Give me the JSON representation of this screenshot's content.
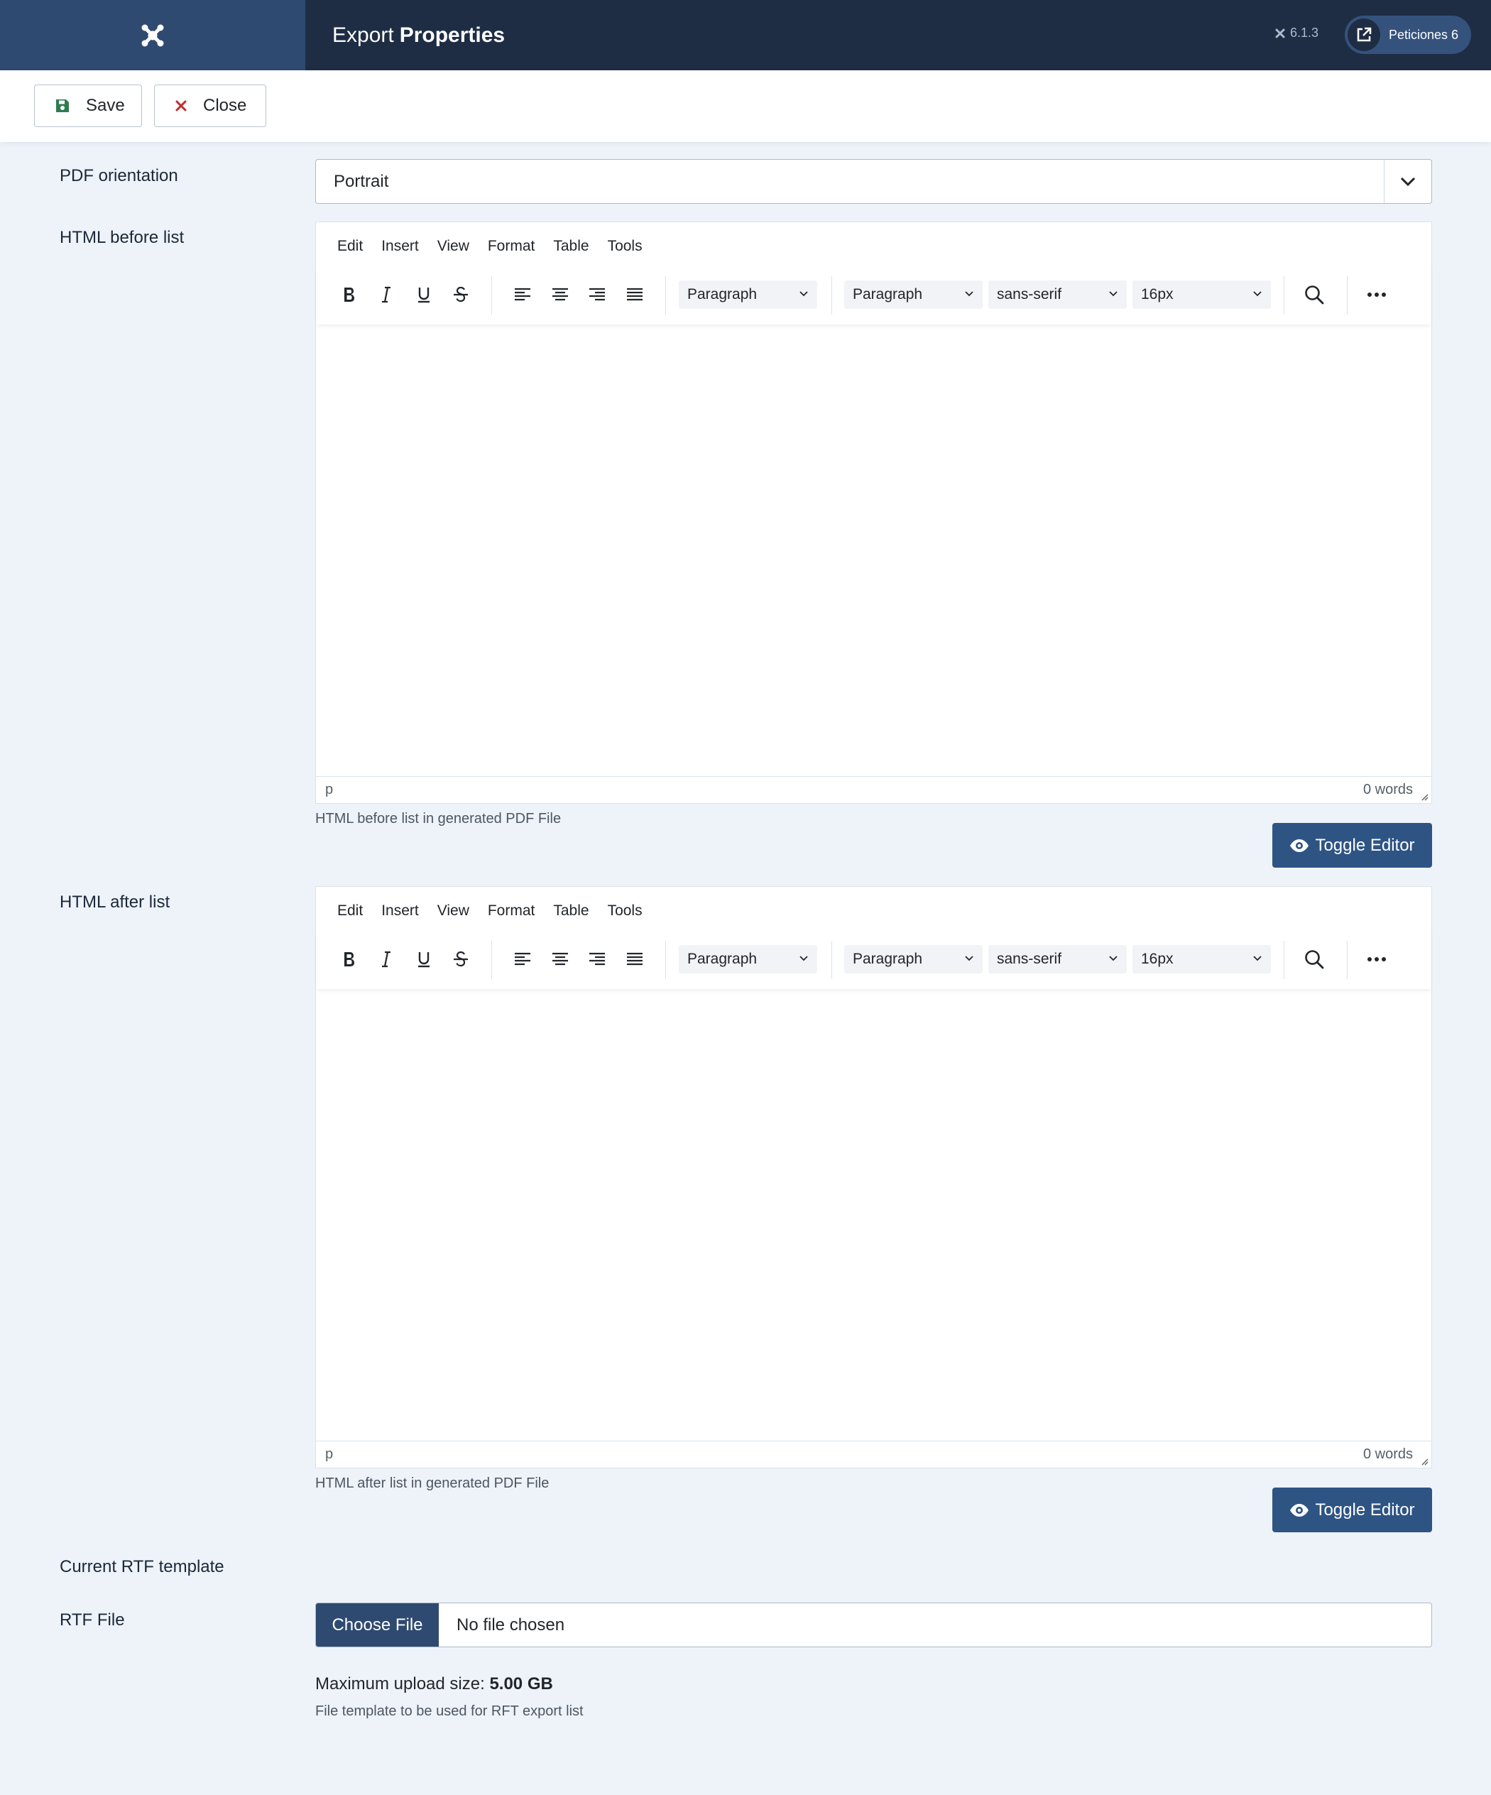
{
  "header": {
    "title_prefix": "Export",
    "title_main": "Properties",
    "version": "6.1.3",
    "site_link_label": "Peticiones 6"
  },
  "toolbar": {
    "save_label": "Save",
    "close_label": "Close"
  },
  "form": {
    "pdf_orientation": {
      "label": "PDF orientation",
      "value": "Portrait"
    },
    "html_before": {
      "label": "HTML before list",
      "help": "HTML before list in generated PDF File",
      "toggle_label": "Toggle Editor"
    },
    "html_after": {
      "label": "HTML after list",
      "help": "HTML after list in generated PDF File",
      "toggle_label": "Toggle Editor"
    },
    "current_rtf_label": "Current RTF template",
    "rtf_file": {
      "label": "RTF File",
      "button": "Choose File",
      "status": "No file chosen",
      "max_upload_prefix": "Maximum upload size:",
      "max_upload_value": "5.00 GB",
      "help": "File template to be used for RFT export list"
    }
  },
  "editor": {
    "menu": [
      "Edit",
      "Insert",
      "View",
      "Format",
      "Table",
      "Tools"
    ],
    "block_format": "Paragraph",
    "styles": "Paragraph",
    "font_family": "sans-serif",
    "font_size": "16px",
    "status_path": "p",
    "word_count": "0 words"
  },
  "colors": {
    "header_bg": "#1f2d44",
    "logo_bg": "#2f4a70",
    "primary_button": "#2e5484",
    "page_bg": "#eef3fa"
  }
}
